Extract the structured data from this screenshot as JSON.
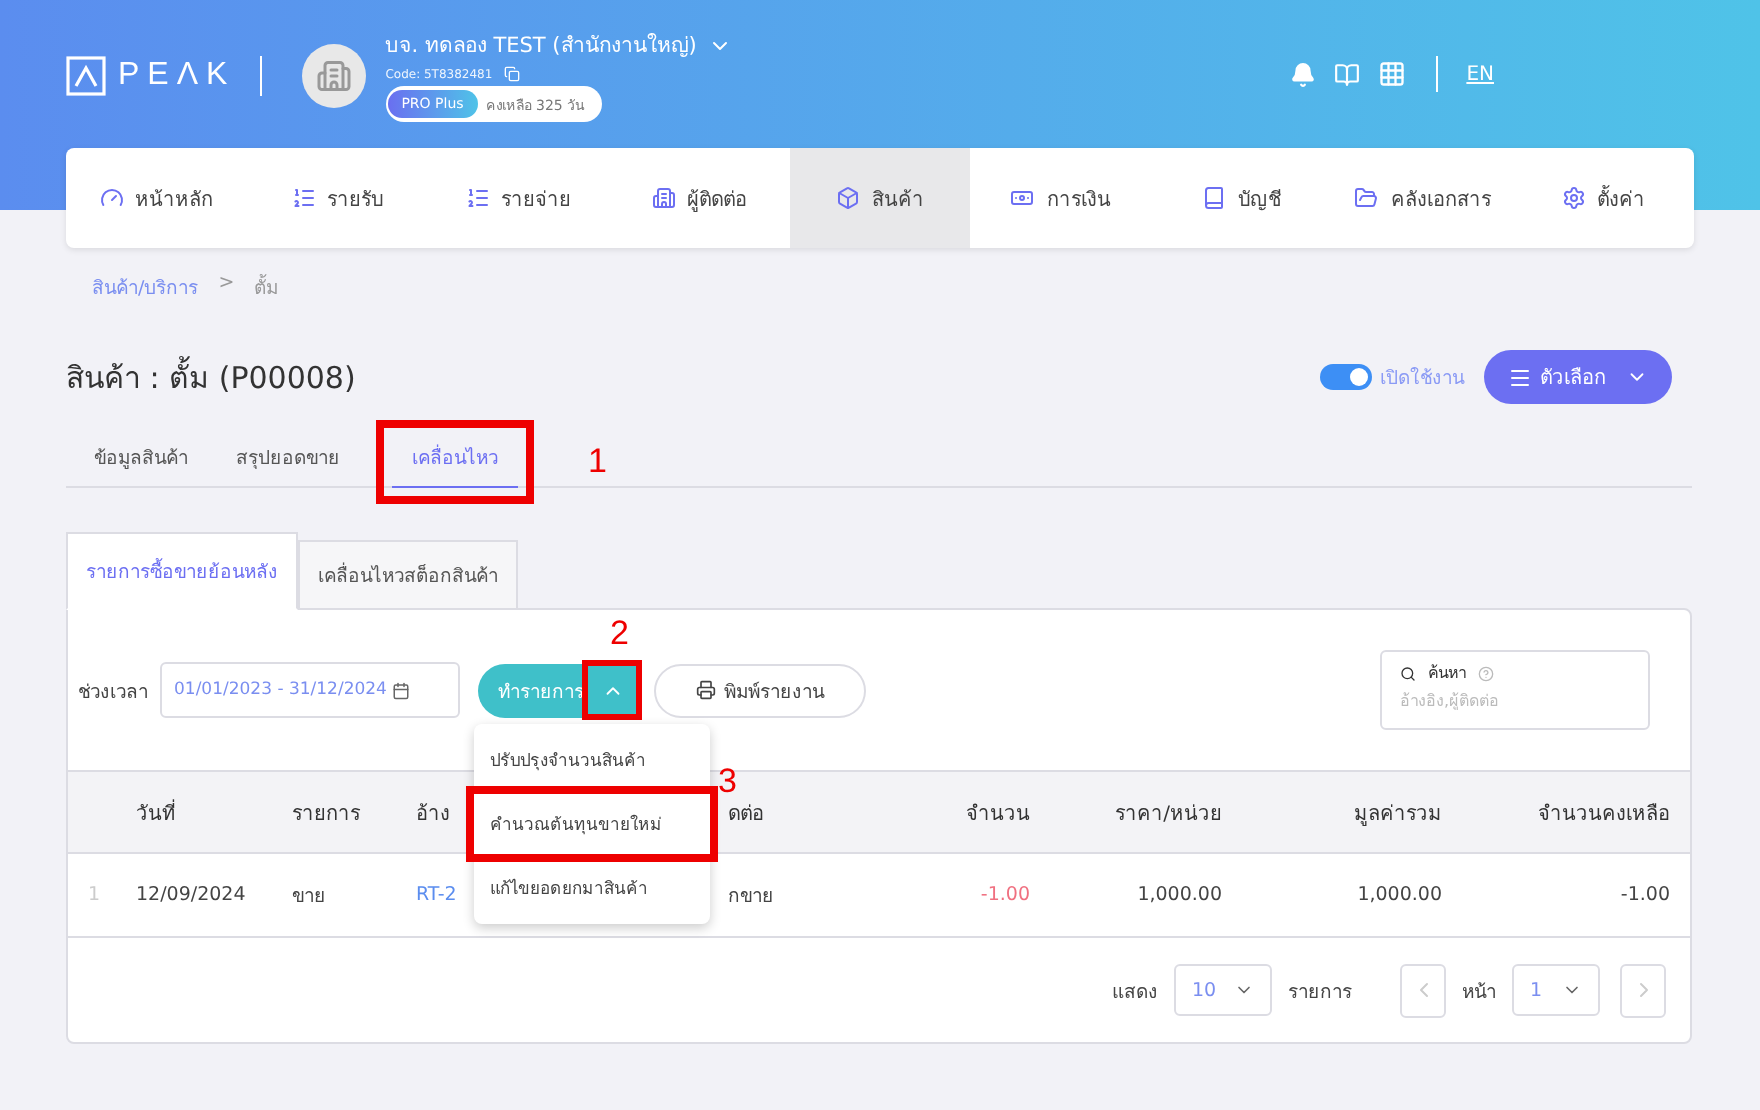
{
  "header": {
    "logo": "PEΛK",
    "company": "บจ. ทดลอง TEST (สำนักงานใหญ่)",
    "code": "Code: 5T8382481",
    "plan": "PRO Plus",
    "remaining": "คงเหลือ 325 วัน",
    "language": "EN"
  },
  "nav": [
    {
      "label": "หน้าหลัก",
      "selected": false
    },
    {
      "label": "รายรับ",
      "selected": false
    },
    {
      "label": "รายจ่าย",
      "selected": false
    },
    {
      "label": "ผู้ติดต่อ",
      "selected": false
    },
    {
      "label": "สินค้า",
      "selected": true
    },
    {
      "label": "การเงิน",
      "selected": false
    },
    {
      "label": "บัญชี",
      "selected": false
    },
    {
      "label": "คลังเอกสาร",
      "selected": false
    },
    {
      "label": "ตั้งค่า",
      "selected": false
    }
  ],
  "breadcrumb": [
    {
      "label": "สินค้า/บริการ",
      "kind": "link"
    },
    {
      "label": ">",
      "kind": "separator"
    },
    {
      "label": "ตั้ม",
      "kind": "current"
    }
  ],
  "title": "สินค้า : ตั้ม (P00008)",
  "active_toggle": {
    "label": "เปิดใช้งาน",
    "on": true
  },
  "options_button": "ตัวเลือก",
  "tabs": [
    {
      "label": "ข้อมูลสินค้า",
      "selected": false
    },
    {
      "label": "สรุปยอดขาย",
      "selected": false
    },
    {
      "label": "เคลื่อนไหว",
      "selected": true,
      "callout": "1"
    }
  ],
  "subtabs": [
    {
      "label": "รายการซื้อขายย้อนหลัง",
      "selected": true
    },
    {
      "label": "เคลื่อนไหวสต็อกสินค้า",
      "selected": false
    }
  ],
  "toolbar": {
    "period_label": "ช่วงเวลา",
    "period": "01/01/2023 - 31/12/2024",
    "action_button": "ทำรายการ",
    "action_callout": "2",
    "print_button": "พิมพ์รายงาน",
    "search_label": "ค้นหา",
    "search_placeholder": "อ้างอิง,ผู้ติดต่อ"
  },
  "action_menu": [
    {
      "label": "ปรับปรุงจำนวนสินค้า"
    },
    {
      "label": "คำนวณต้นทุนขายใหม่",
      "callout": "3"
    },
    {
      "label": "แก้ไขยอดยกมาสินค้า"
    }
  ],
  "table": {
    "columns": [
      "วันที่",
      "รายการ",
      "อ้าง",
      "ดต่อ",
      "จำนวน",
      "ราคา/หน่วย",
      "มูลค่ารวม",
      "จำนวนคงเหลือ"
    ],
    "rows": [
      {
        "index": "1",
        "cells": [
          "12/09/2024",
          "ขาย",
          "RT-2",
          "กขาย",
          "-1.00",
          "1,000.00",
          "1,000.00",
          "-1.00"
        ],
        "negative_quantity": true
      }
    ]
  },
  "pagination": {
    "show_label": "แสดง",
    "page_size": "10",
    "items_label": "รายการ",
    "page_label": "หน้า",
    "page": "1"
  }
}
